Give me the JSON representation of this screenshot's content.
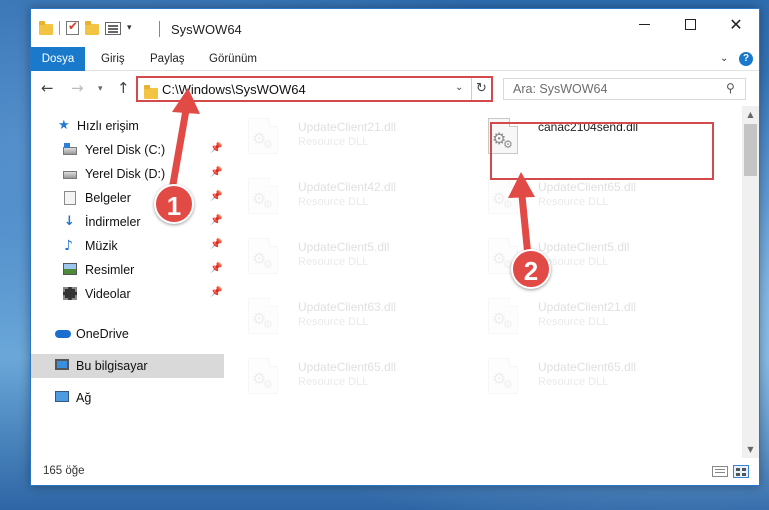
{
  "window": {
    "title": "SysWOW64"
  },
  "ribbon": {
    "tabs": [
      "Dosya",
      "Giriş",
      "Paylaş",
      "Görünüm"
    ],
    "help": "?"
  },
  "navigation": {
    "address_path": "C:\\Windows\\SysWOW64",
    "search_placeholder": "Ara: SysWOW64"
  },
  "sidebar": {
    "items": [
      {
        "label": "Hızlı erişim",
        "icon": "star-icon"
      },
      {
        "label": "Yerel Disk (C:)",
        "icon": "drive-icon",
        "pinned": true
      },
      {
        "label": "Yerel Disk (D:)",
        "icon": "drive-icon",
        "pinned": true
      },
      {
        "label": "Belgeler",
        "icon": "documents-icon",
        "pinned": true
      },
      {
        "label": "İndirmeler",
        "icon": "download-icon",
        "pinned": true
      },
      {
        "label": "Müzik",
        "icon": "music-icon",
        "pinned": true
      },
      {
        "label": "Resimler",
        "icon": "pictures-icon",
        "pinned": true
      },
      {
        "label": "Videolar",
        "icon": "videos-icon",
        "pinned": true
      },
      {
        "label": "OneDrive",
        "icon": "cloud-icon"
      },
      {
        "label": "Bu bilgisayar",
        "icon": "computer-icon",
        "selected": true
      },
      {
        "label": "Ağ",
        "icon": "network-icon"
      }
    ]
  },
  "files": [
    {
      "name": "UpdateClient21.dll",
      "type": "Resource DLL",
      "faded": true
    },
    {
      "name": "canac2104send.dll",
      "type": "",
      "faded": false,
      "highlighted": true
    },
    {
      "name": "UpdateClient42.dll",
      "type": "Resource DLL",
      "faded": true
    },
    {
      "name": "UpdateClient65.dll",
      "type": "Resource DLL",
      "faded": true
    },
    {
      "name": "UpdateClient5.dll",
      "type": "Resource DLL",
      "faded": true
    },
    {
      "name": "UpdateClient5.dll",
      "type": "Resource DLL",
      "faded": true
    },
    {
      "name": "UpdateClient63.dll",
      "type": "Resource DLL",
      "faded": true
    },
    {
      "name": "UpdateClient21.dll",
      "type": "Resource DLL",
      "faded": true
    },
    {
      "name": "UpdateClient65.dll",
      "type": "Resource DLL",
      "faded": true
    },
    {
      "name": "UpdateClient65.dll",
      "type": "Resource DLL",
      "faded": true
    }
  ],
  "status": {
    "item_count": "165 öğe"
  },
  "annotations": {
    "step1": "1",
    "step2": "2",
    "color": "#e24a46"
  },
  "colors": {
    "accent": "#1979ca",
    "highlight_border": "#d44a4a",
    "selected_bg": "#d9d9d9"
  }
}
